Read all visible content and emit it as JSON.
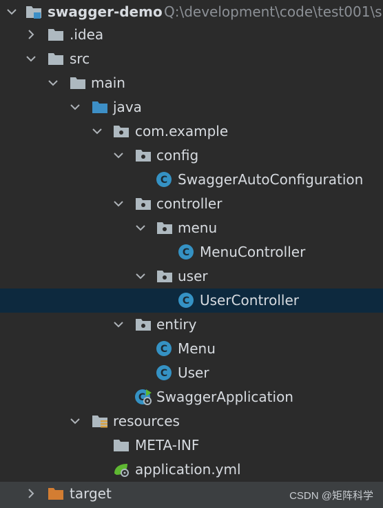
{
  "project": {
    "name": "swagger-demo",
    "path": "Q:\\development\\code\\test001\\s"
  },
  "tree": [
    {
      "label": ".idea",
      "icon": "folder-icon",
      "expanded": false
    },
    {
      "label": "src",
      "icon": "folder-icon",
      "expanded": true
    },
    {
      "label": "main",
      "icon": "folder-icon",
      "expanded": true
    },
    {
      "label": "java",
      "icon": "source-folder-icon",
      "expanded": true
    },
    {
      "label": "com.example",
      "icon": "package-icon",
      "expanded": true
    },
    {
      "label": "config",
      "icon": "package-icon",
      "expanded": true
    },
    {
      "label": "SwaggerAutoConfiguration",
      "icon": "class-icon"
    },
    {
      "label": "controller",
      "icon": "package-icon",
      "expanded": true
    },
    {
      "label": "menu",
      "icon": "package-icon",
      "expanded": true
    },
    {
      "label": "MenuController",
      "icon": "class-icon"
    },
    {
      "label": "user",
      "icon": "package-icon",
      "expanded": true
    },
    {
      "label": "UserController",
      "icon": "class-icon",
      "selected": true
    },
    {
      "label": "entiry",
      "icon": "package-icon",
      "expanded": true
    },
    {
      "label": "Menu",
      "icon": "class-icon"
    },
    {
      "label": "User",
      "icon": "class-icon"
    },
    {
      "label": "SwaggerApplication",
      "icon": "spring-boot-class-icon"
    },
    {
      "label": "resources",
      "icon": "resources-folder-icon",
      "expanded": true
    },
    {
      "label": "META-INF",
      "icon": "folder-icon"
    },
    {
      "label": "application.yml",
      "icon": "spring-config-icon"
    },
    {
      "label": "target",
      "icon": "excluded-folder-icon",
      "expanded": false
    }
  ],
  "watermark": "CSDN @矩阵科学",
  "colors": {
    "background": "#2b2b2b",
    "selection": "#0d293e",
    "folder": "#aeb9c0",
    "source_folder": "#3d8fc6",
    "class_circle": "#3592c4",
    "excluded_folder": "#d37d32",
    "spring_green": "#5fb832"
  }
}
